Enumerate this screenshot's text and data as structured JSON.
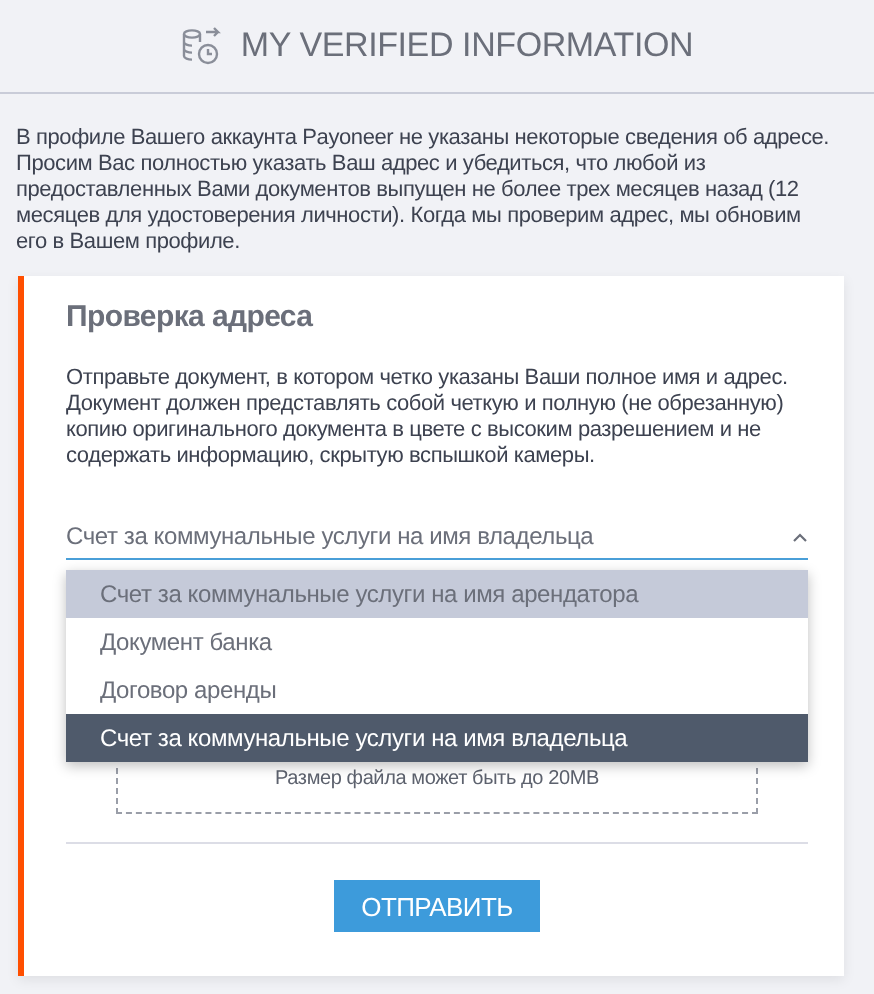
{
  "header": {
    "title": "MY VERIFIED INFORMATION"
  },
  "intro": "В профиле Вашего аккаунта Payoneer не указаны некоторые сведения об адресе. Просим Вас полностью указать Ваш адрес и убедиться, что любой из предоставленных Вами документов выпущен не более трех месяцев назад (12 месяцев для удостоверения личности). Когда мы проверим адрес, мы обновим его в Вашем профиле.",
  "card": {
    "title": "Проверка адреса",
    "description": "Отправьте документ, в котором четко указаны Ваши полное имя и адрес. Документ должен представлять собой четкую и полную (не обрезанную) копию оригинального документа в цвете с высоким разрешением и не содержать информацию, скрытую вспышкой камеры.",
    "select": {
      "value": "Счет за коммунальные услуги на имя владельца",
      "expanded": true,
      "options": [
        {
          "label": "Счет за коммунальные услуги на имя арендатора",
          "selected": false,
          "hovered": true
        },
        {
          "label": "Документ банка",
          "selected": false,
          "hovered": false
        },
        {
          "label": "Договор аренды",
          "selected": false,
          "hovered": false
        },
        {
          "label": "Счет за коммунальные услуги на имя владельца",
          "selected": true,
          "hovered": false
        }
      ]
    },
    "upload": {
      "hint": "Размер файла может быть до 20MB"
    },
    "submit": "ОТПРАВИТЬ"
  }
}
